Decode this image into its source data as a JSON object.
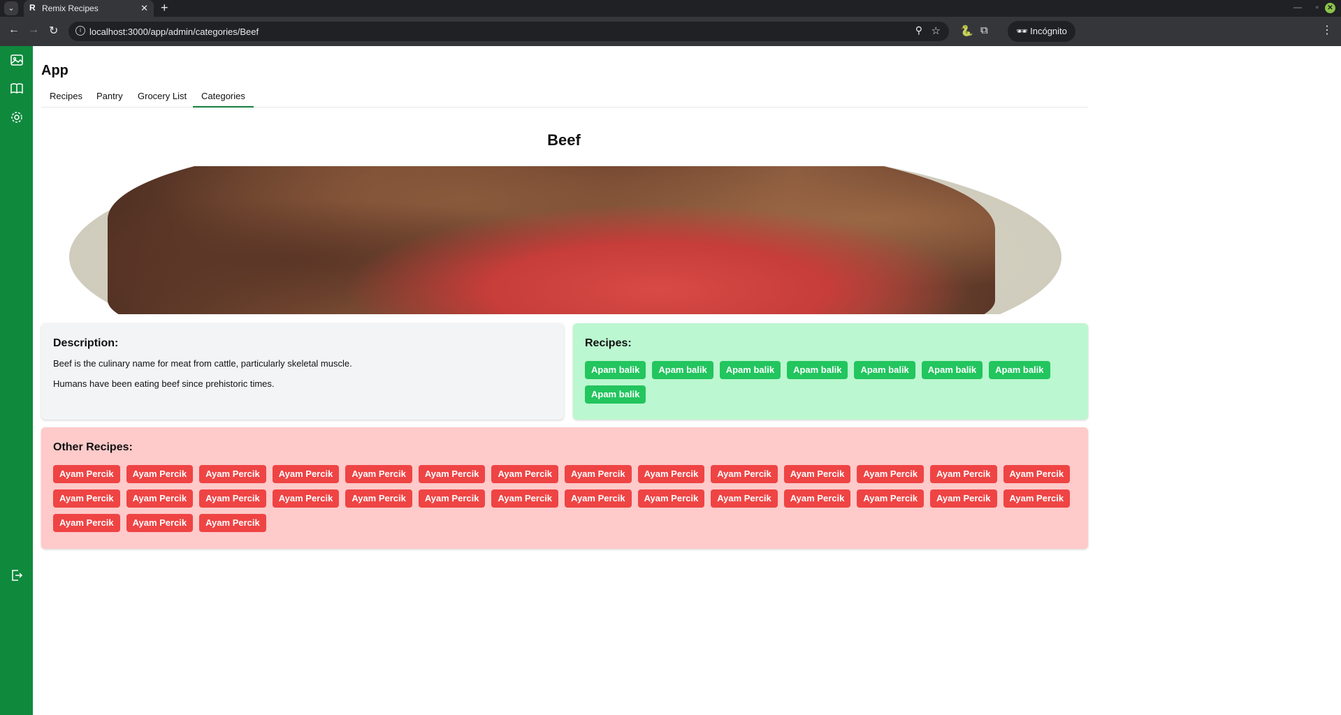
{
  "browser": {
    "tab_title": "Remix Recipes",
    "tab_favicon": "R",
    "url": "localhost:3000/app/admin/categories/Beef",
    "profile_label": "Incógnito"
  },
  "sidebar": {
    "items": [
      {
        "icon": "image-icon"
      },
      {
        "icon": "book-icon"
      },
      {
        "icon": "gear-icon"
      }
    ],
    "logout_icon": "logout-icon"
  },
  "app": {
    "title": "App",
    "tabs": [
      {
        "label": "Recipes"
      },
      {
        "label": "Pantry"
      },
      {
        "label": "Grocery List"
      },
      {
        "label": "Categories",
        "active": true
      }
    ]
  },
  "category": {
    "name": "Beef",
    "description_heading": "Description:",
    "description_lines": [
      "Beef is the culinary name for meat from cattle, particularly skeletal muscle.",
      "Humans have been eating beef since prehistoric times."
    ],
    "recipes_heading": "Recipes:",
    "recipes": [
      "Apam balik",
      "Apam balik",
      "Apam balik",
      "Apam balik",
      "Apam balik",
      "Apam balik",
      "Apam balik",
      "Apam balik"
    ],
    "other_heading": "Other Recipes:",
    "other_recipes": [
      "Ayam Percik",
      "Ayam Percik",
      "Ayam Percik",
      "Ayam Percik",
      "Ayam Percik",
      "Ayam Percik",
      "Ayam Percik",
      "Ayam Percik",
      "Ayam Percik",
      "Ayam Percik",
      "Ayam Percik",
      "Ayam Percik",
      "Ayam Percik",
      "Ayam Percik",
      "Ayam Percik",
      "Ayam Percik",
      "Ayam Percik",
      "Ayam Percik",
      "Ayam Percik",
      "Ayam Percik",
      "Ayam Percik",
      "Ayam Percik",
      "Ayam Percik",
      "Ayam Percik",
      "Ayam Percik",
      "Ayam Percik",
      "Ayam Percik",
      "Ayam Percik",
      "Ayam Percik",
      "Ayam Percik",
      "Ayam Percik"
    ]
  },
  "colors": {
    "sidebar": "#0f8a3d",
    "recipe_chip": "#22c55e",
    "other_chip": "#ef4444",
    "recipes_panel": "#bbf7d0",
    "other_panel": "#fecaca"
  }
}
